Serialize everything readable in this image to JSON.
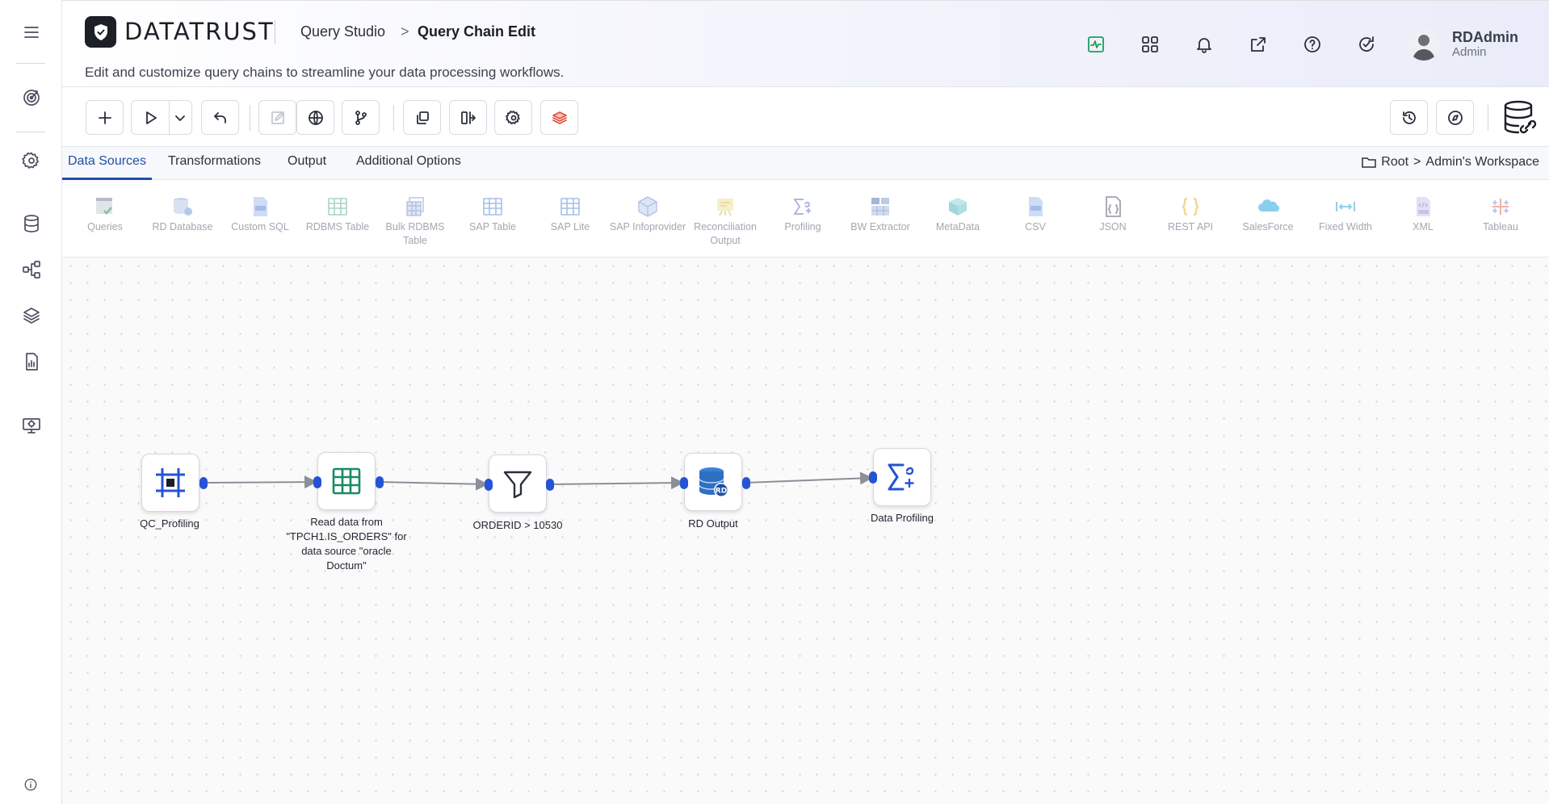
{
  "app": {
    "brand_text": "DATATRUST",
    "breadcrumb": [
      "Query Studio",
      "Query Chain Edit"
    ],
    "breadcrumb_separator": ">",
    "subtitle": "Edit and customize query chains to streamline your data processing workflows."
  },
  "user": {
    "name": "RDAdmin",
    "role": "Admin"
  },
  "colors": {
    "accent": "#1f4fa8",
    "port": "#2553d6",
    "health_icon": "#1aa05a"
  },
  "sidebar": {
    "items": [
      {
        "id": "menu",
        "icon": "hamburger-icon"
      },
      {
        "id": "target",
        "icon": "target-icon"
      },
      {
        "id": "settings",
        "icon": "gear-icon"
      },
      {
        "id": "database",
        "icon": "database-icon"
      },
      {
        "id": "flow",
        "icon": "flow-icon"
      },
      {
        "id": "layers",
        "icon": "layers-icon"
      },
      {
        "id": "report",
        "icon": "report-icon"
      },
      {
        "id": "monitor",
        "icon": "monitor-icon"
      }
    ]
  },
  "tabs": [
    {
      "label": "Data Sources",
      "active": true
    },
    {
      "label": "Transformations",
      "active": false
    },
    {
      "label": "Output",
      "active": false
    },
    {
      "label": "Additional Options",
      "active": false
    }
  ],
  "workspace": {
    "root": "Root",
    "separator": ">",
    "name": "Admin's Workspace"
  },
  "palette": [
    {
      "label": "Queries",
      "icon": "queries-icon"
    },
    {
      "label": "RD Database",
      "icon": "rd-database-icon"
    },
    {
      "label": "Custom SQL",
      "icon": "custom-sql-icon"
    },
    {
      "label": "RDBMS Table",
      "icon": "rdbms-table-icon"
    },
    {
      "label": "Bulk RDBMS Table",
      "icon": "bulk-rdbms-table-icon"
    },
    {
      "label": "SAP Table",
      "icon": "sap-table-icon"
    },
    {
      "label": "SAP Lite",
      "icon": "sap-lite-icon"
    },
    {
      "label": "SAP Infoprovider",
      "icon": "sap-infoprovider-icon"
    },
    {
      "label": "Reconciliation Output",
      "icon": "reconciliation-output-icon"
    },
    {
      "label": "Profiling",
      "icon": "profiling-icon"
    },
    {
      "label": "BW Extractor",
      "icon": "bw-extractor-icon"
    },
    {
      "label": "MetaData",
      "icon": "metadata-icon"
    },
    {
      "label": "CSV",
      "icon": "csv-icon"
    },
    {
      "label": "JSON",
      "icon": "json-icon"
    },
    {
      "label": "REST API",
      "icon": "rest-api-icon"
    },
    {
      "label": "SalesForce",
      "icon": "salesforce-icon"
    },
    {
      "label": "Fixed Width",
      "icon": "fixed-width-icon"
    },
    {
      "label": "XML",
      "icon": "xml-icon"
    },
    {
      "label": "Tableau",
      "icon": "tableau-icon"
    }
  ],
  "flow": {
    "nodes": [
      {
        "label": "QC_Profiling",
        "icon": "frame-icon"
      },
      {
        "label": "Read data from \"TPCH1.IS_ORDERS\" for data source \"oracle Doctum\"",
        "icon": "table-icon"
      },
      {
        "label": "ORDERID > 10530",
        "icon": "filter-icon"
      },
      {
        "label": "RD Output",
        "icon": "rd-output-icon"
      },
      {
        "label": "Data Profiling",
        "icon": "sigma-alpha-icon"
      }
    ]
  }
}
